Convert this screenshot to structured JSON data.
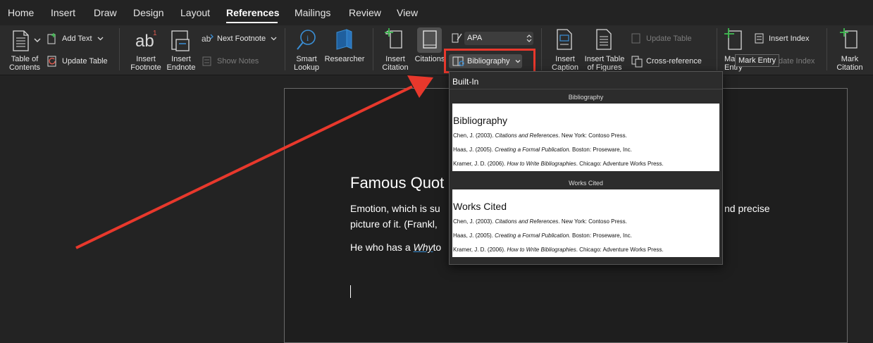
{
  "tabs": [
    "Home",
    "Insert",
    "Draw",
    "Design",
    "Layout",
    "References",
    "Mailings",
    "Review",
    "View"
  ],
  "ribbon": {
    "toc_label_1": "Table of",
    "toc_label_2": "Contents",
    "add_text": "Add Text",
    "update_table": "Update Table",
    "insert_footnote_1": "Insert",
    "insert_footnote_2": "Footnote",
    "insert_endnote_1": "Insert",
    "insert_endnote_2": "Endnote",
    "next_footnote": "Next Footnote",
    "show_notes": "Show Notes",
    "smart_lookup_1": "Smart",
    "smart_lookup_2": "Lookup",
    "researcher": "Researcher",
    "insert_citation_1": "Insert",
    "insert_citation_2": "Citation",
    "citations": "Citations",
    "style_value": "APA",
    "bibliography": "Bibliography",
    "insert_caption_1": "Insert",
    "insert_caption_2": "Caption",
    "insert_tof_1": "Insert Table",
    "insert_tof_2": "of Figures",
    "update_table_2": "Update Table",
    "cross_reference": "Cross-reference",
    "mark_entry_1": "Mark",
    "mark_entry_2": "Entry",
    "insert_index": "Insert Index",
    "update_index": "Update Index",
    "mark_citation_1": "Mark",
    "mark_citation_2": "Citation",
    "tooltip": "Mark Entry"
  },
  "document": {
    "title": "Famous Quot",
    "line1": "Emotion, which is su",
    "line1_end": "nd precise",
    "line2": "picture of it. (Frankl,",
    "line3_start": "He who has a",
    "line3_word": "Why",
    "line3_end": "to"
  },
  "dropdown": {
    "header": "Built-In",
    "section1": "Bibliography",
    "section1_title": "Bibliography",
    "section2": "Works Cited",
    "section2_title": "Works Cited",
    "entries": [
      {
        "pre": "Chen, J. (2003). ",
        "it": "Citations and References",
        "post": ". New York: Contoso Press."
      },
      {
        "pre": "Haas, J. (2005). ",
        "it": "Creating a Formal Publication",
        "post": ". Boston: Proseware, Inc."
      },
      {
        "pre": "Kramer, J. D. (2006). ",
        "it": "How to Write Bibliographies",
        "post": ". Chicago: Adventure Works Press."
      }
    ]
  },
  "colors": {
    "accent_red": "#e8382c",
    "ribbon_bg": "#2b2b2b",
    "document_bg": "#1e1e1e",
    "icon_green": "#3fb950",
    "icon_blue": "#3a8fd6"
  }
}
